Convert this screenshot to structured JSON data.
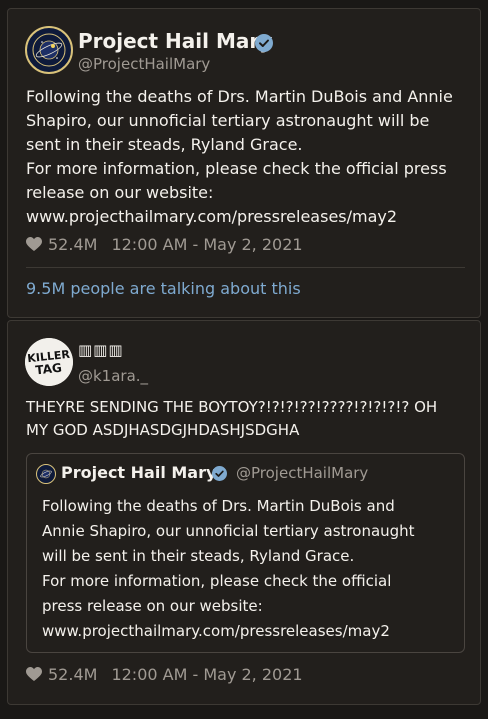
{
  "tweet1": {
    "name": "Project Hail Mary",
    "handle": "@ProjectHailMary",
    "body_lines": [
      "Following the deaths of Drs. Martin DuBois and Annie",
      "Shapiro, our unnoficial tertiary astronaught will be",
      "sent in their steads, Ryland Grace.",
      "For more information, please check the official press",
      "release on our website:",
      "www.projecthailmary.com/pressreleases/may2"
    ],
    "likes": "52.4M",
    "timestamp": "12:00 AM - May 2, 2021",
    "talking": "9.5M people are talking about this"
  },
  "tweet2": {
    "name": "▥▥▥",
    "handle": "@k1ara._",
    "avatar_text": "KILLER TAG",
    "body_lines": [
      "THEYRE SENDING THE BOYTOY?!?!?!??!????!?!?!?!? OH",
      "MY GOD ASDJHASDGJHDASHJSDGHA"
    ],
    "quote": {
      "name": "Project Hail Mary",
      "handle": "@ProjectHailMary",
      "body_lines": [
        "Following the deaths of Drs. Martin DuBois and",
        "Annie Shapiro, our unnoficial tertiary astronaught",
        "will be sent in their steads, Ryland Grace.",
        "For more information, please check the official",
        "press release on our website:",
        "www.projecthailmary.com/pressreleases/may2"
      ]
    },
    "likes": "52.4M",
    "timestamp": "12:00 AM - May 2, 2021"
  },
  "colors": {
    "background": "#1a1816",
    "card": "#221f1c",
    "text": "#f4f1ec",
    "muted": "#a09a93",
    "accent": "#7faad0"
  }
}
